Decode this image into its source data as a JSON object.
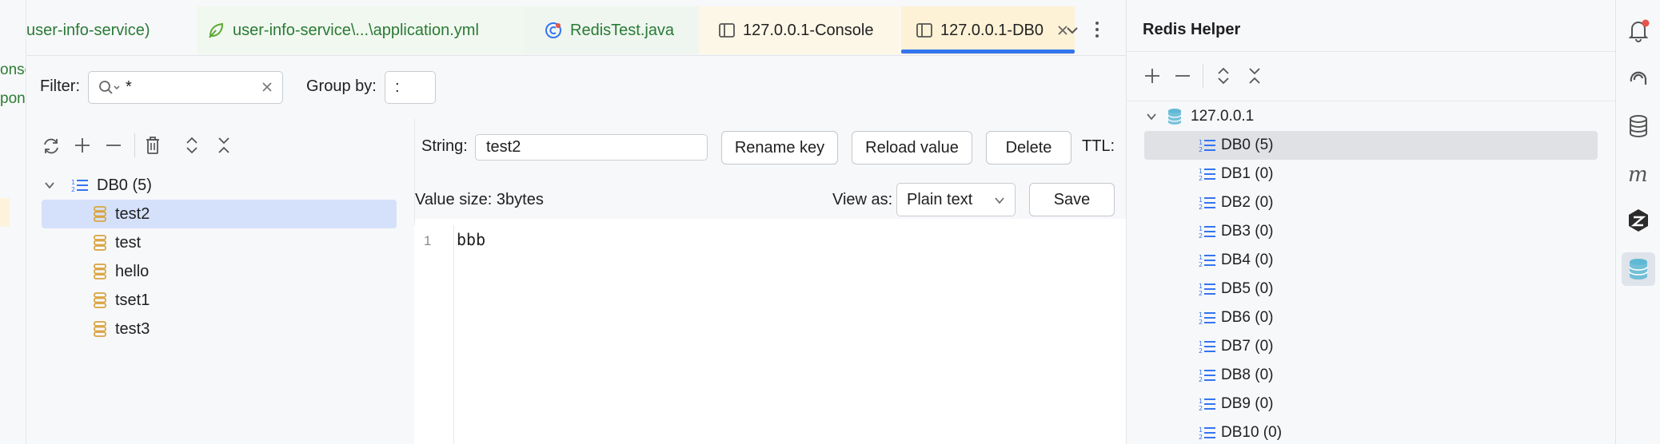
{
  "gutter": {
    "line1": "onse",
    "line2": "pon"
  },
  "tabs": [
    {
      "label": "user-info-service)",
      "icon": "none",
      "active": false
    },
    {
      "label": "user-info-service\\...\\application.yml",
      "icon": "spring-leaf-icon",
      "active": false
    },
    {
      "label": "RedisTest.java",
      "icon": "test-class-icon",
      "active": false
    },
    {
      "label": "127.0.0.1-Console",
      "icon": "panel-icon",
      "active": false
    },
    {
      "label": "127.0.0.1-DB0",
      "icon": "panel-icon",
      "active": true
    }
  ],
  "filter": {
    "label": "Filter:",
    "value": "*",
    "group_label": "Group by:",
    "group_value": ":"
  },
  "key_tree": {
    "db_label": "DB0 (5)",
    "keys": [
      "test2",
      "test",
      "hello",
      "tset1",
      "test3"
    ],
    "selected": "test2"
  },
  "value_panel": {
    "string_label": "String:",
    "key_value": "test2",
    "rename_label": "Rename key",
    "reload_label": "Reload value",
    "delete_label": "Delete",
    "ttl_label": "TTL:",
    "size_text": "Value size: 3bytes",
    "view_as_label": "View as:",
    "view_as_value": "Plain text",
    "save_label": "Save",
    "line_number": "1",
    "content": "bbb"
  },
  "helper": {
    "title": "Redis Helper",
    "host": "127.0.0.1",
    "databases": [
      "DB0 (5)",
      "DB1 (0)",
      "DB2 (0)",
      "DB3 (0)",
      "DB4 (0)",
      "DB5 (0)",
      "DB6 (0)",
      "DB7 (0)",
      "DB8 (0)",
      "DB9 (0)",
      "DB10 (0)"
    ],
    "selected_db": "DB0 (5)"
  },
  "colors": {
    "accent": "#3574f0",
    "selection": "#d5e1fb",
    "key_icon": "#d9a441",
    "db_icon": "#3574f0",
    "redis_icon": "#5fb8d4"
  }
}
